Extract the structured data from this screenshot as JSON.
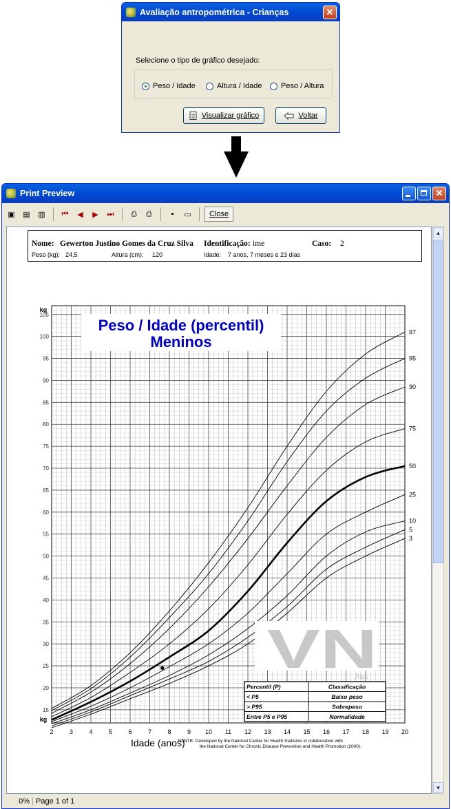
{
  "dialog": {
    "title": "Avaliação antropométrica - Crianças",
    "close_glyph": "✕",
    "prompt": "Selecione o tipo de gráfico desejado:",
    "options": [
      {
        "label": "Peso / Idade",
        "selected": true
      },
      {
        "label": "Altura / Idade",
        "selected": false
      },
      {
        "label": "Peso / Altura",
        "selected": false
      }
    ],
    "view_button": "Visualizar gráfico",
    "back_button": "Voltar"
  },
  "preview": {
    "title": "Print Preview",
    "close_label": "Close",
    "status_zoom": "0%",
    "status_page": "Page 1 of 1"
  },
  "patient": {
    "name_label": "Nome:",
    "name": "Gewerton Justino Gomes da Cruz Silva",
    "id_label": "Identificação:",
    "id": "ime",
    "case_label": "Caso:",
    "case": "2",
    "weight_label": "Peso (kg):",
    "weight": "24,5",
    "height_label": "Altura (cm):",
    "height": "120",
    "age_label": "Idade:",
    "age": "7 anos, 7 meses e 23 dias"
  },
  "chart_data": {
    "type": "line",
    "title": "Peso / Idade (percentil)",
    "subtitle": "Meninos",
    "xlabel": "Idade (anos)",
    "ylabel": "kg",
    "xlim": [
      2,
      20
    ],
    "ylim": [
      12,
      107
    ],
    "x_ticks": [
      2,
      3,
      4,
      5,
      6,
      7,
      8,
      9,
      10,
      11,
      12,
      13,
      14,
      15,
      16,
      17,
      18,
      19,
      20
    ],
    "y_ticks": [
      15,
      20,
      25,
      30,
      35,
      40,
      45,
      50,
      55,
      60,
      65,
      70,
      75,
      80,
      85,
      90,
      95,
      100,
      105
    ],
    "x": [
      2,
      4,
      6,
      8,
      10,
      12,
      14,
      16,
      18,
      20
    ],
    "series": [
      {
        "name": "3",
        "values": [
          10.9,
          14.0,
          17.5,
          21.0,
          25.0,
          30.0,
          37.0,
          45.0,
          50.0,
          54.0
        ]
      },
      {
        "name": "5",
        "values": [
          11.3,
          14.5,
          18.2,
          22.0,
          26.0,
          31.5,
          38.5,
          47.0,
          52.0,
          56.0
        ]
      },
      {
        "name": "10",
        "values": [
          11.8,
          15.0,
          18.8,
          22.8,
          27.5,
          33.5,
          41.0,
          50.0,
          55.5,
          58.0
        ]
      },
      {
        "name": "25",
        "values": [
          12.3,
          15.8,
          20.0,
          24.8,
          30.0,
          37.0,
          46.0,
          55.0,
          60.0,
          64.0
        ]
      },
      {
        "name": "50",
        "values": [
          12.7,
          16.8,
          21.5,
          27.0,
          33.0,
          42.0,
          53.0,
          62.5,
          68.0,
          70.5
        ]
      },
      {
        "name": "75",
        "values": [
          13.4,
          17.8,
          23.5,
          30.0,
          38.0,
          48.0,
          59.5,
          69.5,
          76.0,
          79.0
        ]
      },
      {
        "name": "90",
        "values": [
          14.2,
          19.0,
          25.5,
          33.5,
          43.0,
          54.0,
          66.0,
          77.0,
          84.5,
          88.5
        ]
      },
      {
        "name": "95",
        "values": [
          14.8,
          19.8,
          27.0,
          36.0,
          46.0,
          58.0,
          71.5,
          83.0,
          90.5,
          95.0
        ]
      },
      {
        "name": "97",
        "values": [
          15.3,
          20.5,
          28.0,
          37.5,
          48.5,
          61.0,
          75.0,
          87.5,
          96.0,
          101.0
        ]
      }
    ],
    "patient_point": {
      "x": 7.64,
      "y": 24.5
    },
    "grid": true,
    "source_lines": [
      "FONTE: Developed by the National Center for Health Statistics in collaboration with",
      "the National Center for Chronic Disease Prevention and Health Promotion (2000)."
    ],
    "legend_table": {
      "headers": [
        "Percentil (P)",
        "Classificação"
      ],
      "rows": [
        [
          "< P5",
          "Baixo peso"
        ],
        [
          "> P95",
          "Sobrepeso"
        ],
        [
          "Entre P5 e P95",
          "Normalidade"
        ]
      ]
    },
    "watermark": "VN",
    "watermark_sub": "Plus"
  }
}
